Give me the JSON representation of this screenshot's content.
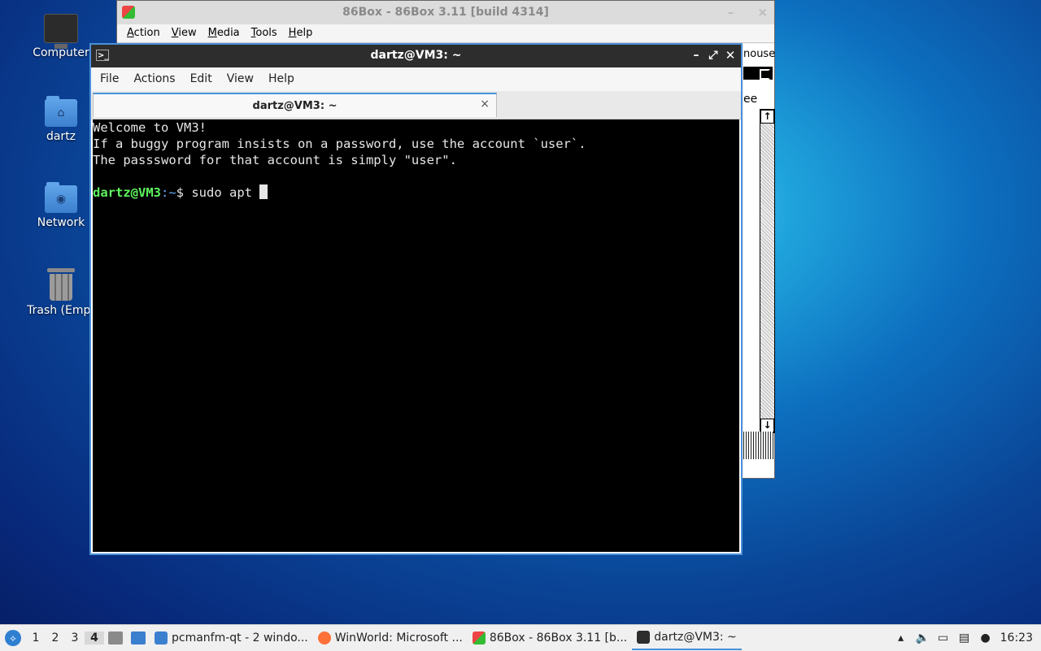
{
  "desktop": {
    "icons": [
      {
        "label": "Computer",
        "icon": "computer-icon"
      },
      {
        "label": "dartz",
        "icon": "home-folder-icon"
      },
      {
        "label": "Network",
        "icon": "network-folder-icon"
      },
      {
        "label": "Trash (Empt",
        "icon": "trash-icon"
      }
    ]
  },
  "box86": {
    "title": "86Box - 86Box 3.11 [build 4314]",
    "menu": [
      "Action",
      "View",
      "Media",
      "Tools",
      "Help"
    ],
    "partial_text_mouse": "nouse",
    "partial_text_ee": "ee"
  },
  "terminal": {
    "title": "dartz@VM3: ~",
    "menu": [
      "File",
      "Actions",
      "Edit",
      "View",
      "Help"
    ],
    "tab_label": "dartz@VM3: ~",
    "lines": [
      "Welcome to VM3!",
      "If a buggy program insists on a password, use the account `user`.",
      "The passsword for that account is simply \"user\".",
      ""
    ],
    "prompt_user": "dartz@VM3",
    "prompt_path": ":~",
    "prompt_symbol": "$ ",
    "command": "sudo apt "
  },
  "taskbar": {
    "workspaces": [
      "1",
      "2",
      "3",
      "4"
    ],
    "active_workspace": "4",
    "tasks": [
      {
        "label": "pcmanfm-qt - 2 windo...",
        "icon": "folder-icon",
        "color": "#3b7fcf"
      },
      {
        "label": "WinWorld: Microsoft ...",
        "icon": "firefox-icon",
        "color": "#ff7139"
      },
      {
        "label": "86Box - 86Box 3.11 [b...",
        "icon": "86box-icon",
        "color": "#d33"
      },
      {
        "label": "dartz@VM3: ~",
        "icon": "terminal-icon",
        "color": "#2d2d2d"
      }
    ],
    "clock": "16:23"
  },
  "colors": {
    "accent": "#4a90d9",
    "prompt_user": "#5ff65f",
    "prompt_path": "#6aa9ff"
  }
}
